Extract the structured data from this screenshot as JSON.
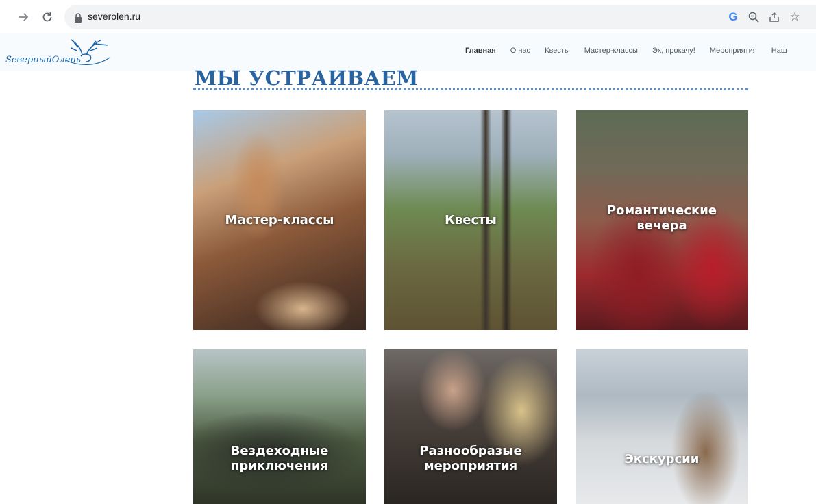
{
  "browser": {
    "url": "severolen.ru"
  },
  "header": {
    "logo_text": "ЅеверныйОлень",
    "nav": [
      {
        "label": "Главная",
        "active": true
      },
      {
        "label": "О нас"
      },
      {
        "label": "Квесты"
      },
      {
        "label": "Мастер-классы"
      },
      {
        "label": "Эх, прокачу!"
      },
      {
        "label": "Мероприятия"
      },
      {
        "label": "Наш"
      }
    ]
  },
  "section": {
    "title": "МЫ УСТРАИВАЕМ"
  },
  "cards": [
    {
      "label": "Мастер-классы"
    },
    {
      "label": "Квесты"
    },
    {
      "label": "Романтические\nвечера"
    },
    {
      "label": "Вездеходные\nприключения"
    },
    {
      "label": "Разнообразые\nмероприятия"
    },
    {
      "label": "Экскурсии"
    }
  ],
  "colors": {
    "accent": "#2a64a0",
    "rule": "#5c8fcb"
  }
}
